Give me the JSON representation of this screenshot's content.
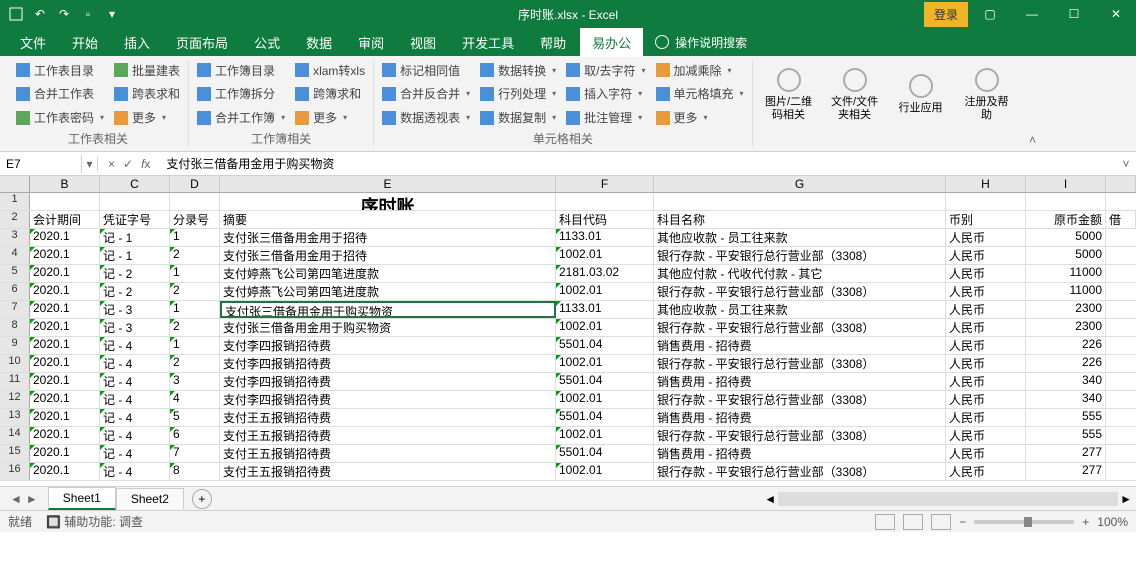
{
  "title": "序时账.xlsx - Excel",
  "login": "登录",
  "menu": [
    "文件",
    "开始",
    "插入",
    "页面布局",
    "公式",
    "数据",
    "审阅",
    "视图",
    "开发工具",
    "帮助",
    "易办公"
  ],
  "active_menu": 10,
  "tell_me": "操作说明搜索",
  "ribbon": {
    "g1": {
      "label": "工作表相关",
      "items": [
        [
          "工作表目录",
          "批量建表"
        ],
        [
          "合并工作表",
          "跨表求和"
        ],
        [
          "工作表密码",
          "更多"
        ]
      ]
    },
    "g2": {
      "label": "工作簿相关",
      "items": [
        [
          "工作簿目录",
          "xlam转xls"
        ],
        [
          "工作簿拆分",
          "跨簿求和"
        ],
        [
          "合并工作簿",
          "更多"
        ]
      ]
    },
    "g3": {
      "label": "单元格相关",
      "items": [
        [
          "标记相同值",
          "数据转换",
          "取/去字符",
          "加减乘除"
        ],
        [
          "合并反合并",
          "行列处理",
          "插入字符",
          "单元格填充"
        ],
        [
          "数据透视表",
          "数据复制",
          "批注管理",
          "更多"
        ]
      ]
    },
    "big": [
      "图片/二维码相关",
      "文件/文件夹相关",
      "行业应用",
      "注册及帮助"
    ]
  },
  "namebox": "E7",
  "formula": "支付张三借备用金用于购买物资",
  "cols": [
    "B",
    "C",
    "D",
    "E",
    "F",
    "G",
    "H",
    "I"
  ],
  "headers": {
    "b": "会计期间",
    "c": "凭证字号",
    "d": "分录号",
    "e": "摘要",
    "f": "科目代码",
    "g": "科目名称",
    "h": "币别",
    "i": "原币金额",
    "j": "借"
  },
  "title_cell": "序时账",
  "rows": [
    {
      "b": "2020.1",
      "c": "记 - 1",
      "d": "1",
      "e": "支付张三借备用金用于招待",
      "f": "1133.01",
      "g": "其他应收款 - 员工往来款",
      "h": "人民币",
      "i": "5000"
    },
    {
      "b": "2020.1",
      "c": "记 - 1",
      "d": "2",
      "e": "支付张三借备用金用于招待",
      "f": "1002.01",
      "g": "银行存款 - 平安银行总行营业部（3308）",
      "h": "人民币",
      "i": "5000"
    },
    {
      "b": "2020.1",
      "c": "记 - 2",
      "d": "1",
      "e": "支付婷燕飞公司第四笔进度款",
      "f": "2181.03.02",
      "g": "其他应付款 - 代收代付款 - 其它",
      "h": "人民币",
      "i": "11000"
    },
    {
      "b": "2020.1",
      "c": "记 - 2",
      "d": "2",
      "e": "支付婷燕飞公司第四笔进度款",
      "f": "1002.01",
      "g": "银行存款 - 平安银行总行营业部（3308）",
      "h": "人民币",
      "i": "11000"
    },
    {
      "b": "2020.1",
      "c": "记 - 3",
      "d": "1",
      "e": "支付张三借备用金用于购买物资",
      "f": "1133.01",
      "g": "其他应收款 - 员工往来款",
      "h": "人民币",
      "i": "2300"
    },
    {
      "b": "2020.1",
      "c": "记 - 3",
      "d": "2",
      "e": "支付张三借备用金用于购买物资",
      "f": "1002.01",
      "g": "银行存款 - 平安银行总行营业部（3308）",
      "h": "人民币",
      "i": "2300"
    },
    {
      "b": "2020.1",
      "c": "记 - 4",
      "d": "1",
      "e": "支付李四报销招待费",
      "f": "5501.04",
      "g": "销售费用 - 招待费",
      "h": "人民币",
      "i": "226"
    },
    {
      "b": "2020.1",
      "c": "记 - 4",
      "d": "2",
      "e": "支付李四报销招待费",
      "f": "1002.01",
      "g": "银行存款 - 平安银行总行营业部（3308）",
      "h": "人民币",
      "i": "226"
    },
    {
      "b": "2020.1",
      "c": "记 - 4",
      "d": "3",
      "e": "支付李四报销招待费",
      "f": "5501.04",
      "g": "销售费用 - 招待费",
      "h": "人民币",
      "i": "340"
    },
    {
      "b": "2020.1",
      "c": "记 - 4",
      "d": "4",
      "e": "支付李四报销招待费",
      "f": "1002.01",
      "g": "银行存款 - 平安银行总行营业部（3308）",
      "h": "人民币",
      "i": "340"
    },
    {
      "b": "2020.1",
      "c": "记 - 4",
      "d": "5",
      "e": "支付王五报销招待费",
      "f": "5501.04",
      "g": "销售费用 - 招待费",
      "h": "人民币",
      "i": "555"
    },
    {
      "b": "2020.1",
      "c": "记 - 4",
      "d": "6",
      "e": "支付王五报销招待费",
      "f": "1002.01",
      "g": "银行存款 - 平安银行总行营业部（3308）",
      "h": "人民币",
      "i": "555"
    },
    {
      "b": "2020.1",
      "c": "记 - 4",
      "d": "7",
      "e": "支付王五报销招待费",
      "f": "5501.04",
      "g": "销售费用 - 招待费",
      "h": "人民币",
      "i": "277"
    },
    {
      "b": "2020.1",
      "c": "记 - 4",
      "d": "8",
      "e": "支付王五报销招待费",
      "f": "1002.01",
      "g": "银行存款 - 平安银行总行营业部（3308）",
      "h": "人民币",
      "i": "277"
    }
  ],
  "sheets": [
    "Sheet1",
    "Sheet2"
  ],
  "active_sheet": 0,
  "status": {
    "ready": "就绪",
    "acc": "辅助功能: 调查",
    "zoom": "100%"
  }
}
